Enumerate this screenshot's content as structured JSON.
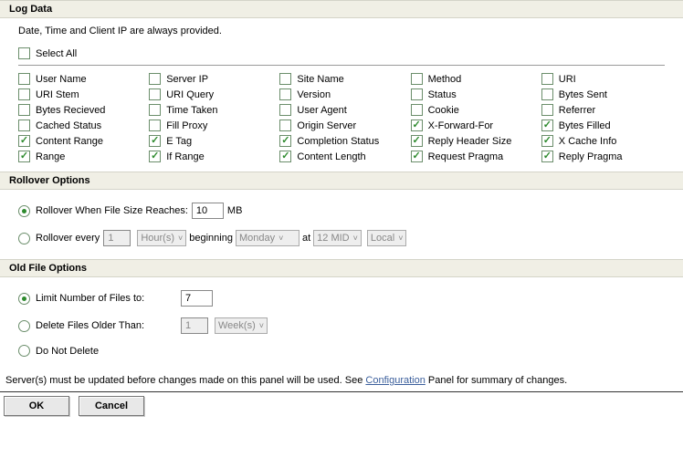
{
  "logData": {
    "title": "Log Data",
    "description": "Date, Time and Client IP are always provided.",
    "selectAll": "Select All",
    "columns": [
      [
        "User Name",
        "URI Stem",
        "Bytes Recieved",
        "Cached Status",
        "Content Range",
        "Range"
      ],
      [
        "Server IP",
        "URI Query",
        "Time Taken",
        "Fill Proxy",
        "E Tag",
        "If Range"
      ],
      [
        "Site Name",
        "Version",
        "User Agent",
        "Origin Server",
        "Completion Status",
        "Content Length"
      ],
      [
        "Method",
        "Status",
        "Cookie",
        "X-Forward-For",
        "Reply Header Size",
        "Request Pragma"
      ],
      [
        "URI",
        "Bytes Sent",
        "Referrer",
        "Bytes Filled",
        "X Cache Info",
        "Reply Pragma"
      ]
    ],
    "checked": [
      "Content Range",
      "Range",
      "E Tag",
      "If Range",
      "Completion Status",
      "Content Length",
      "X-Forward-For",
      "Reply Header Size",
      "Request Pragma",
      "Bytes Filled",
      "X Cache Info",
      "Reply Pragma"
    ]
  },
  "rollover": {
    "title": "Rollover Options",
    "sizeLabel": "Rollover When File Size Reaches:",
    "sizeValue": "10",
    "sizeUnit": "MB",
    "everyLabel": "Rollover every",
    "everyValue": "1",
    "unitSelect": "Hour(s)",
    "beginningLabel": "beginning",
    "daySelect": "Monday",
    "atLabel": "at",
    "timeSelect": "12 MID",
    "tzSelect": "Local"
  },
  "oldFile": {
    "title": "Old File Options",
    "limitLabel": "Limit Number of Files to:",
    "limitValue": "7",
    "deleteLabel": "Delete Files Older Than:",
    "deleteValue": "1",
    "deleteUnit": "Week(s)",
    "noDeleteLabel": "Do Not Delete"
  },
  "footer": {
    "noteBefore": "Server(s) must be updated before changes made on this panel will be used. See ",
    "link": "Configuration",
    "noteAfter": " Panel for summary of changes."
  },
  "buttons": {
    "ok": "OK",
    "cancel": "Cancel"
  }
}
